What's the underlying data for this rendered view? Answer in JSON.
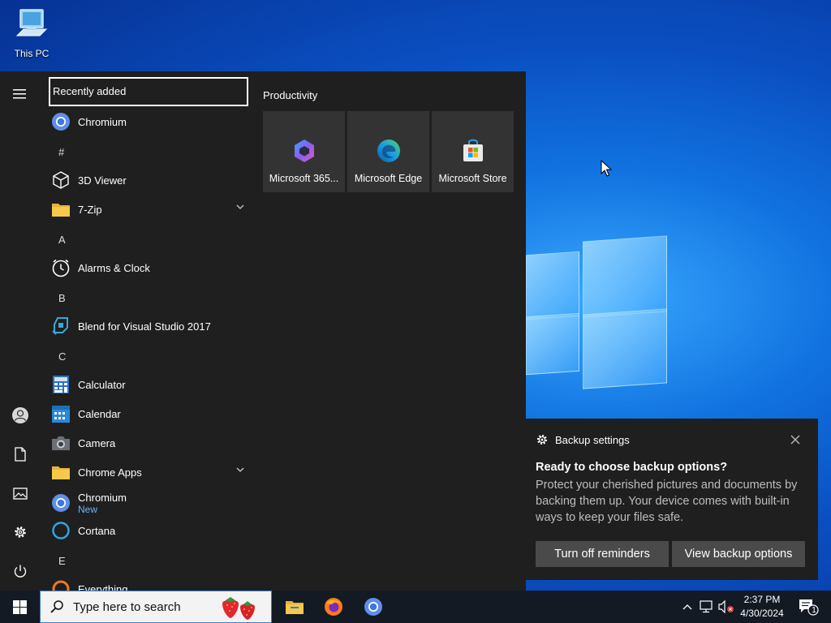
{
  "desktop": {
    "icons": [
      {
        "label": "This PC",
        "icon": "computer-icon"
      }
    ]
  },
  "start_menu": {
    "recently_added_header": "Recently added",
    "apps": [
      {
        "label": "Chromium",
        "icon": "chromium-icon"
      },
      {
        "label": "3D Viewer",
        "icon": "cube-icon"
      },
      {
        "label": "7-Zip",
        "icon": "folder-icon",
        "expandable": true
      },
      {
        "label": "Alarms & Clock",
        "icon": "clock-icon"
      },
      {
        "label": "Blend for Visual Studio 2017",
        "icon": "blend-icon"
      },
      {
        "label": "Calculator",
        "icon": "calculator-icon"
      },
      {
        "label": "Calendar",
        "icon": "calendar-icon"
      },
      {
        "label": "Camera",
        "icon": "camera-icon"
      },
      {
        "label": "Chrome Apps",
        "icon": "folder-icon",
        "expandable": true
      },
      {
        "label": "Chromium",
        "icon": "chromium-icon",
        "sublabel": "New"
      },
      {
        "label": "Cortana",
        "icon": "cortana-icon"
      },
      {
        "label": "Everything",
        "icon": "everything-icon"
      }
    ],
    "letters": [
      "#",
      "A",
      "B",
      "C",
      "E"
    ],
    "tiles_group": "Productivity",
    "tiles": [
      {
        "label": "Microsoft 365...",
        "icon": "m365-icon"
      },
      {
        "label": "Microsoft Edge",
        "icon": "edge-icon"
      },
      {
        "label": "Microsoft Store",
        "icon": "store-icon"
      }
    ]
  },
  "notification": {
    "app": "Backup settings",
    "title": "Ready to choose backup options?",
    "body": "Protect your cherished pictures and documents by backing them up. Your device comes with built-in ways to keep your files safe.",
    "buttons": [
      "Turn off reminders",
      "View backup options"
    ]
  },
  "taskbar": {
    "search_placeholder": "Type here to search",
    "clock_time": "2:37 PM",
    "clock_date": "4/30/2024",
    "notification_count": "1"
  },
  "colors": {
    "accent": "#0078d7",
    "menu_bg": "#1f1f1f",
    "tile_bg": "#333333",
    "sublabel": "#6ab4ff"
  }
}
